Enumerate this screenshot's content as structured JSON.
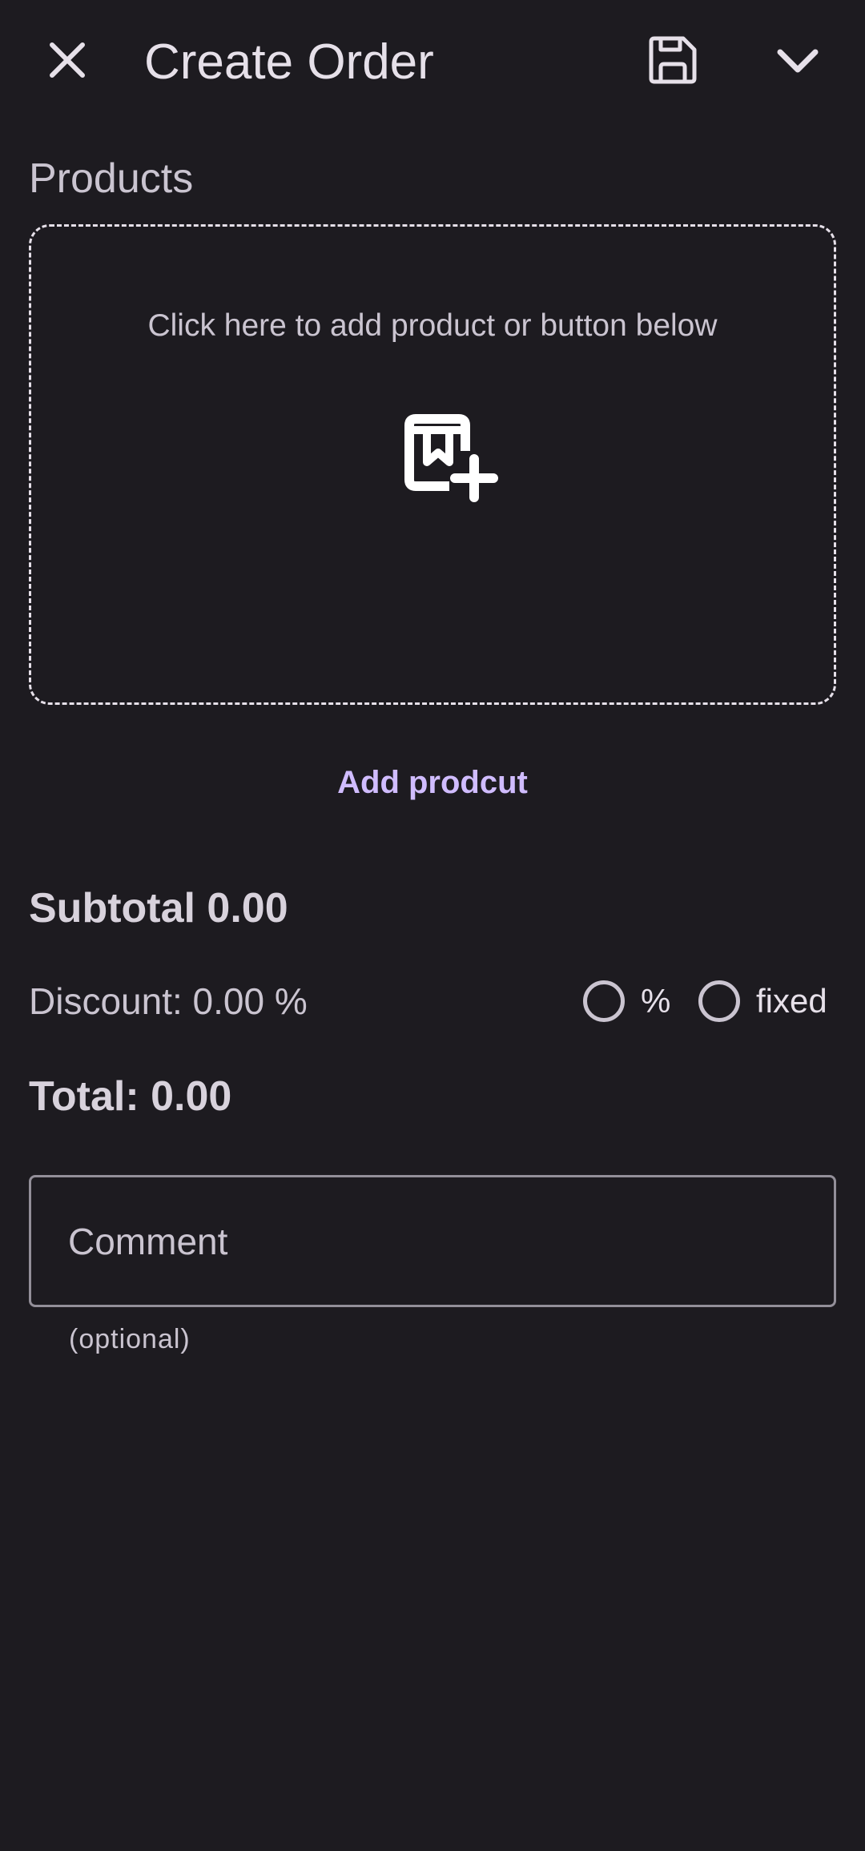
{
  "header": {
    "title": "Create Order",
    "close_icon": "close-icon",
    "save_icon": "save-icon",
    "expand_icon": "chevron-down-icon"
  },
  "products": {
    "label": "Products",
    "dropzone_icon": "add-product-icon",
    "dropzone_text": "Click here to add product or button below",
    "add_button_label": "Add prodcut"
  },
  "summary": {
    "subtotal": "Subtotal 0.00",
    "discount": "Discount: 0.00 %",
    "total": "Total: 0.00"
  },
  "discount_type": {
    "options": [
      {
        "label": "%",
        "selected": false
      },
      {
        "label": "fixed",
        "selected": false
      }
    ]
  },
  "comment": {
    "placeholder": "Comment",
    "value": "",
    "helper": "(optional)"
  },
  "colors": {
    "background": "#1d1b20",
    "accent": "#d0bcff",
    "text": "#e6e0e9",
    "muted_text": "#cac4d0",
    "outline": "#938f99"
  }
}
